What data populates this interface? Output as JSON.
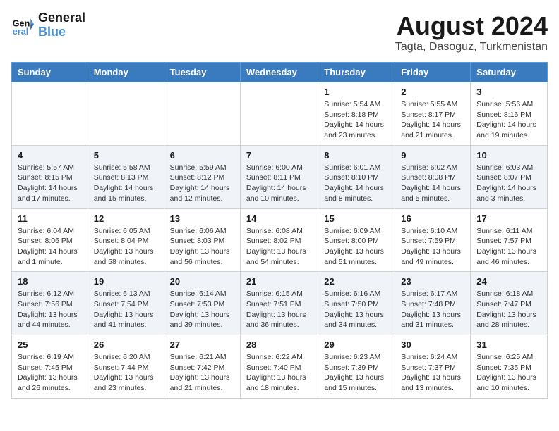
{
  "header": {
    "logo_line1": "General",
    "logo_line2": "Blue",
    "month_year": "August 2024",
    "location": "Tagta, Dasoguz, Turkmenistan"
  },
  "days_of_week": [
    "Sunday",
    "Monday",
    "Tuesday",
    "Wednesday",
    "Thursday",
    "Friday",
    "Saturday"
  ],
  "weeks": [
    [
      {
        "day": "",
        "info": ""
      },
      {
        "day": "",
        "info": ""
      },
      {
        "day": "",
        "info": ""
      },
      {
        "day": "",
        "info": ""
      },
      {
        "day": "1",
        "info": "Sunrise: 5:54 AM\nSunset: 8:18 PM\nDaylight: 14 hours and 23 minutes."
      },
      {
        "day": "2",
        "info": "Sunrise: 5:55 AM\nSunset: 8:17 PM\nDaylight: 14 hours and 21 minutes."
      },
      {
        "day": "3",
        "info": "Sunrise: 5:56 AM\nSunset: 8:16 PM\nDaylight: 14 hours and 19 minutes."
      }
    ],
    [
      {
        "day": "4",
        "info": "Sunrise: 5:57 AM\nSunset: 8:15 PM\nDaylight: 14 hours and 17 minutes."
      },
      {
        "day": "5",
        "info": "Sunrise: 5:58 AM\nSunset: 8:13 PM\nDaylight: 14 hours and 15 minutes."
      },
      {
        "day": "6",
        "info": "Sunrise: 5:59 AM\nSunset: 8:12 PM\nDaylight: 14 hours and 12 minutes."
      },
      {
        "day": "7",
        "info": "Sunrise: 6:00 AM\nSunset: 8:11 PM\nDaylight: 14 hours and 10 minutes."
      },
      {
        "day": "8",
        "info": "Sunrise: 6:01 AM\nSunset: 8:10 PM\nDaylight: 14 hours and 8 minutes."
      },
      {
        "day": "9",
        "info": "Sunrise: 6:02 AM\nSunset: 8:08 PM\nDaylight: 14 hours and 5 minutes."
      },
      {
        "day": "10",
        "info": "Sunrise: 6:03 AM\nSunset: 8:07 PM\nDaylight: 14 hours and 3 minutes."
      }
    ],
    [
      {
        "day": "11",
        "info": "Sunrise: 6:04 AM\nSunset: 8:06 PM\nDaylight: 14 hours and 1 minute."
      },
      {
        "day": "12",
        "info": "Sunrise: 6:05 AM\nSunset: 8:04 PM\nDaylight: 13 hours and 58 minutes."
      },
      {
        "day": "13",
        "info": "Sunrise: 6:06 AM\nSunset: 8:03 PM\nDaylight: 13 hours and 56 minutes."
      },
      {
        "day": "14",
        "info": "Sunrise: 6:08 AM\nSunset: 8:02 PM\nDaylight: 13 hours and 54 minutes."
      },
      {
        "day": "15",
        "info": "Sunrise: 6:09 AM\nSunset: 8:00 PM\nDaylight: 13 hours and 51 minutes."
      },
      {
        "day": "16",
        "info": "Sunrise: 6:10 AM\nSunset: 7:59 PM\nDaylight: 13 hours and 49 minutes."
      },
      {
        "day": "17",
        "info": "Sunrise: 6:11 AM\nSunset: 7:57 PM\nDaylight: 13 hours and 46 minutes."
      }
    ],
    [
      {
        "day": "18",
        "info": "Sunrise: 6:12 AM\nSunset: 7:56 PM\nDaylight: 13 hours and 44 minutes."
      },
      {
        "day": "19",
        "info": "Sunrise: 6:13 AM\nSunset: 7:54 PM\nDaylight: 13 hours and 41 minutes."
      },
      {
        "day": "20",
        "info": "Sunrise: 6:14 AM\nSunset: 7:53 PM\nDaylight: 13 hours and 39 minutes."
      },
      {
        "day": "21",
        "info": "Sunrise: 6:15 AM\nSunset: 7:51 PM\nDaylight: 13 hours and 36 minutes."
      },
      {
        "day": "22",
        "info": "Sunrise: 6:16 AM\nSunset: 7:50 PM\nDaylight: 13 hours and 34 minutes."
      },
      {
        "day": "23",
        "info": "Sunrise: 6:17 AM\nSunset: 7:48 PM\nDaylight: 13 hours and 31 minutes."
      },
      {
        "day": "24",
        "info": "Sunrise: 6:18 AM\nSunset: 7:47 PM\nDaylight: 13 hours and 28 minutes."
      }
    ],
    [
      {
        "day": "25",
        "info": "Sunrise: 6:19 AM\nSunset: 7:45 PM\nDaylight: 13 hours and 26 minutes."
      },
      {
        "day": "26",
        "info": "Sunrise: 6:20 AM\nSunset: 7:44 PM\nDaylight: 13 hours and 23 minutes."
      },
      {
        "day": "27",
        "info": "Sunrise: 6:21 AM\nSunset: 7:42 PM\nDaylight: 13 hours and 21 minutes."
      },
      {
        "day": "28",
        "info": "Sunrise: 6:22 AM\nSunset: 7:40 PM\nDaylight: 13 hours and 18 minutes."
      },
      {
        "day": "29",
        "info": "Sunrise: 6:23 AM\nSunset: 7:39 PM\nDaylight: 13 hours and 15 minutes."
      },
      {
        "day": "30",
        "info": "Sunrise: 6:24 AM\nSunset: 7:37 PM\nDaylight: 13 hours and 13 minutes."
      },
      {
        "day": "31",
        "info": "Sunrise: 6:25 AM\nSunset: 7:35 PM\nDaylight: 13 hours and 10 minutes."
      }
    ]
  ]
}
